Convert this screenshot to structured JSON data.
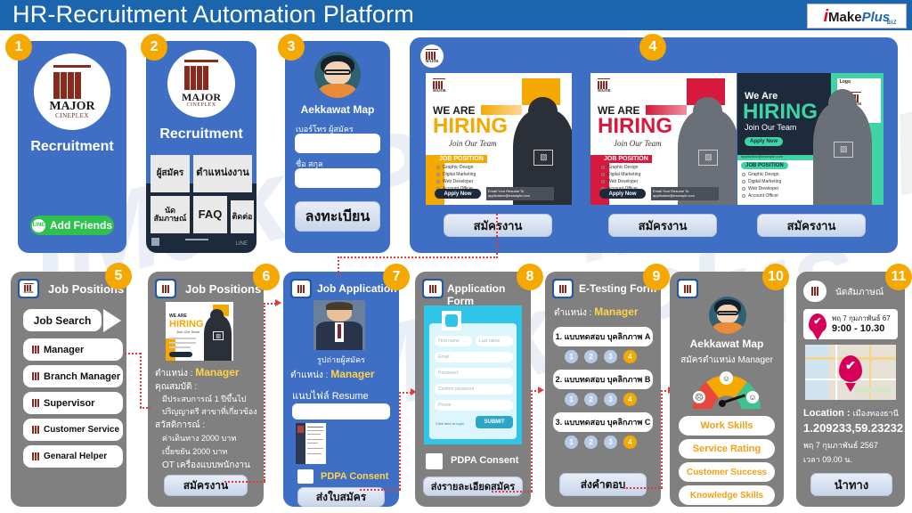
{
  "header": {
    "title": "HR-Recruitment  Automation Platform",
    "logo": {
      "i": "i",
      "make": "Make",
      "plus": "Plus",
      "biz": "BIZ"
    }
  },
  "watermark": {
    "text": "iMakePlus"
  },
  "brand": {
    "major_name": "MAJOR",
    "major_sub": "CINEPLEX"
  },
  "panels": {
    "p1": {
      "number": "1",
      "recruitment": "Recruitment",
      "line_button": "Add Friends",
      "line_badge": "LINE"
    },
    "p2": {
      "number": "2",
      "recruitment": "Recruitment",
      "menu": [
        "ผู้สมัคร",
        "ตำแหน่งงาน",
        "นัด\nสัมภาษณ์",
        "FAQ",
        "ติดต่อ"
      ]
    },
    "p3": {
      "number": "3",
      "name": "Aekkawat Map",
      "label_phone": "เบอร์โทร ผู้สมัคร",
      "label_fullname": "ชื่อ สกุล",
      "phone_value": "",
      "fullname_value": "",
      "register_button": "ลงทะเบียน"
    },
    "p4": {
      "number": "4",
      "cards": [
        {
          "we_are": "WE ARE",
          "hiring": "HIRING",
          "script": "Join Our Team",
          "job_position": "JOB POSITION",
          "jobs": [
            "Graphic Design",
            "Digital Marketing",
            "Web Developer",
            "Account Officer"
          ],
          "apply": "Apply Now",
          "email_line1": "Email Your Resume To",
          "email_line2": "application@example.com",
          "accent": "#f5a800",
          "apply_button": "สมัครงาน"
        },
        {
          "we_are": "WE ARE",
          "hiring": "HIRING",
          "script": "Join Our Team",
          "job_position": "JOB POSITION",
          "jobs": [
            "Graphic Design",
            "Digital Marketing",
            "Web Developer",
            "Account Officer"
          ],
          "apply": "Apply Now",
          "email_line1": "Email Your Resume To",
          "email_line2": "application@example.com",
          "accent": "#d6193c",
          "apply_button": "สมัครงาน"
        },
        {
          "we_are": "We Are",
          "hiring": "HIRING",
          "script": "Join Our Team",
          "job_position": "JOB POSITION",
          "jobs": [
            "Graphic Design",
            "Digital Marketing",
            "Web Developer",
            "Account Officer"
          ],
          "apply": "Apply Now",
          "email_line1": "Email Your Resume To",
          "email_line2": "application@example.com",
          "accent": "#3fd3a6",
          "logo_label": "Logo",
          "apply_button": "สมัครงาน"
        }
      ]
    },
    "p5": {
      "number": "5",
      "title": "Job Positions",
      "search_button": "Job Search",
      "items": [
        "Manager",
        "Branch Manager",
        "Supervisor",
        "Customer Service",
        "Genaral Helper"
      ]
    },
    "p6": {
      "number": "6",
      "title": "Job Positions",
      "pos_label": "ตำแหน่ง : ",
      "pos_value": "Manager",
      "qual_label": "คุณสมบัติ :",
      "qual_1": "มีประสบการณ์ 1 ปีขึ้นไป",
      "qual_2": "ปริญญาตรี สาขาที่เกี่ยวข้อง",
      "benefit_label": "สวัสดิการณ์ :",
      "benefit_1": "ค่าเดินทาง  2000 บาท",
      "benefit_2": "เบี้ยขยัน 2000 บาท",
      "benefit_3": "OT เครื่องแบบพนักงาน",
      "apply_button": "สมัครงาน",
      "card_we_are": "WE ARE",
      "card_hiring": "HIRING",
      "card_script": "Join Our Team"
    },
    "p7": {
      "number": "7",
      "title": "Job Application",
      "photo_caption": "รูปถ่ายผู้สมัคร",
      "pos_label": "ตำแหน่ง : ",
      "pos_value": "Manager",
      "resume_label": "แนบไฟล์ Resume",
      "resume_value": "",
      "pdpa": "PDPA Consent",
      "submit_button": "ส่งใบสมัคร"
    },
    "p8": {
      "number": "8",
      "title": "Application  Form",
      "form_fields": [
        "First name",
        "Last name",
        "Email",
        "Password",
        "Confirm password",
        "Phone"
      ],
      "login_hint": "Click here to",
      "login_link": "login",
      "form_submit": "SUBMIT",
      "pdpa": "PDPA Consent",
      "submit_button": "ส่งรายละเอียดสมัคร"
    },
    "p9": {
      "number": "9",
      "title": "E-Testing Form",
      "pos_label": "ตำแหน่ง : ",
      "pos_value": "Manager",
      "questions": [
        {
          "text": "1. แบบทดสอบ บุคลิกภาพ A",
          "options": [
            "1",
            "2",
            "3",
            "4"
          ],
          "selected": 3
        },
        {
          "text": "2. แบบทดสอบ บุคลิกภาพ B",
          "options": [
            "1",
            "2",
            "3",
            "4"
          ],
          "selected": 3
        },
        {
          "text": "3. แบบทดสอบ บุคลิกภาพ C",
          "options": [
            "1",
            "2",
            "3",
            "4"
          ],
          "selected": 3
        }
      ],
      "submit_button": "ส่งคำตอบ"
    },
    "p10": {
      "number": "10",
      "name": "Aekkawat Map",
      "subtitle": "สมัครตำแหน่ง Manager",
      "skills": [
        "Work Skills",
        "Service Rating",
        "Customer Success",
        "Knowledge Skills"
      ]
    },
    "p11": {
      "number": "11",
      "title": "นัดสัมภาษณ์",
      "appt_date": "พฤ 7 กุมภาพันธ์ 67",
      "appt_time": "9:00  -  10.30",
      "location_label": "Location : ",
      "location_value": "เมืองทองธานี",
      "coords": "1.209233,59.23232",
      "date_long": "พฤ 7 กุมภาพันธ์ 2567",
      "time_long": "เวลา 09.00 น.",
      "navigate_button": "นำทาง"
    }
  },
  "colors": {
    "header_blue": "#1b64ae",
    "panel_blue": "#3e6fc4",
    "panel_grey": "#808080",
    "badge_orange": "#f5a800",
    "accent_yellow": "#ffd24a",
    "line_green": "#2ec14e",
    "connector_red": "#e23b3b"
  }
}
